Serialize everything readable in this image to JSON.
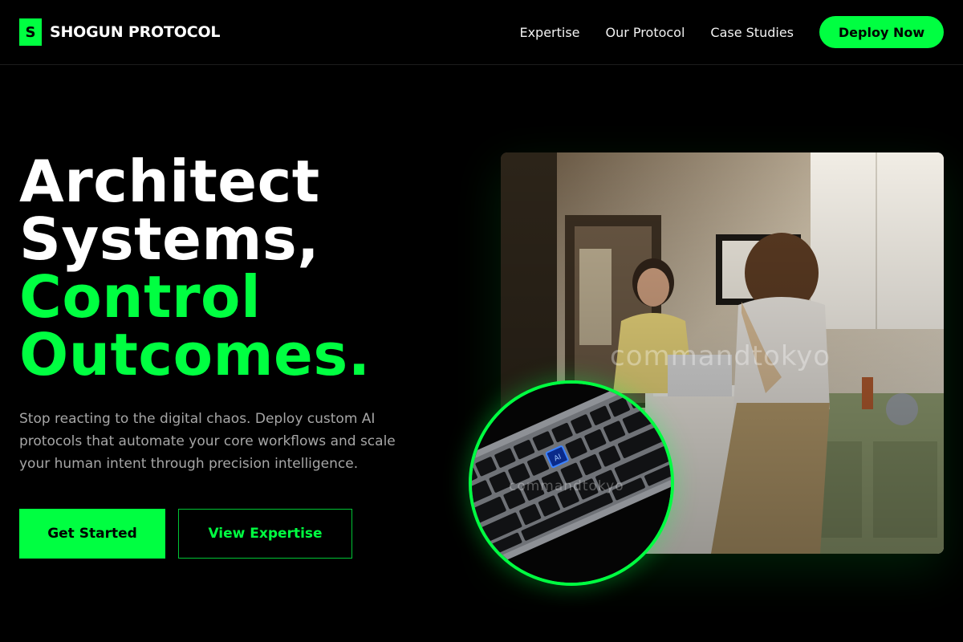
{
  "brand": {
    "mark": "S",
    "name": "SHOGUN PROTOCOL"
  },
  "nav": {
    "links": [
      "Expertise",
      "Our Protocol",
      "Case Studies"
    ],
    "cta": "Deploy Now"
  },
  "hero": {
    "headline_white": [
      "Architect",
      "Systems,"
    ],
    "headline_green": [
      "Control",
      "Outcomes."
    ],
    "lede": "Stop reacting to the digital chaos. Deploy custom AI protocols that automate your core workflows and scale your human intent through precision intelligence.",
    "primary_cta": "Get Started",
    "secondary_cta": "View Expertise"
  },
  "media": {
    "photo_watermark": "commandtokyo",
    "inset_watermark": "commandtokyo",
    "inset_key_label": "AI"
  },
  "colors": {
    "accent": "#00ff41",
    "background": "#000000",
    "muted_text": "#a6a6a6"
  }
}
